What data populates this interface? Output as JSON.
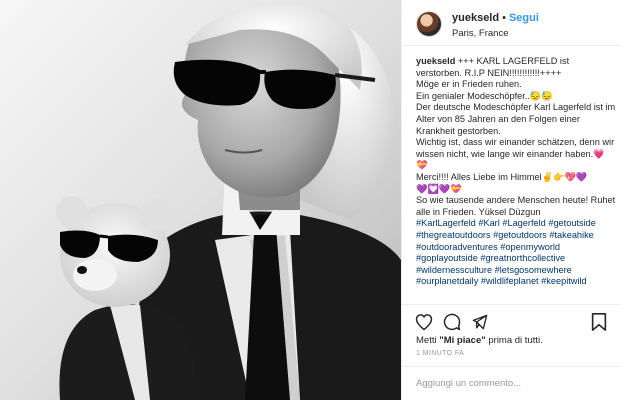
{
  "post": {
    "username": "yuekseld",
    "follow_label": "Segui",
    "separator": "•",
    "location": "Paris, France",
    "photo_alt": "Karl Lagerfeld with teddy bear",
    "caption": {
      "user": "yuekseld",
      "lines": [
        "+++ KARL LAGERFELD ist verstorben. R.I.P NEIN!!!!!!!!!!!!++++",
        "Möge er in Frieden ruhen.",
        "Ein genialer Modeschöpfer..😓😓",
        "Der deutsche Modeschöpfer Karl Lagerfeld ist im Alter von 85 Jahren an den Folgen einer Krankheit gestorben.",
        "Wichtig ist, dass wir einander schätzen, denn wir wissen nicht, wie lange wir einander haben.💗💝",
        "Merci!!!! Alles Liebe im Himmel✌️👉💖💜",
        "💜💟💜💝",
        "So wie tausende andere Menschen heute! Ruhet alle in Frieden. Yüksel Düzgun"
      ],
      "hashtags": [
        "#KarlLagerfeld",
        "#Karl",
        "#Lagerfeld",
        "#getoutside",
        "#thegreatoutdoors",
        "#getoutdoors",
        "#takeahike",
        "#outdooradventures",
        "#openmyworld",
        "#goplayoutside",
        "#greatnorthcollective",
        "#wildernessculture",
        "#letsgosomewhere",
        "#ourplanetdaily",
        "#wildlifeplanet",
        "#keepitwild"
      ]
    },
    "likes": {
      "prefix": "Metti",
      "bold": "\"Mi piace\"",
      "suffix": "prima di tutti."
    },
    "timestamp": "1 MINUTO FA",
    "comment_placeholder": "Aggiungi un commento..."
  },
  "icons": [
    "heart-icon",
    "comment-icon",
    "share-icon",
    "bookmark-icon"
  ],
  "colors": {
    "link_blue": "#3897f0",
    "hashtag": "#003569",
    "text": "#262626",
    "muted": "#999999",
    "border": "#efefef"
  }
}
